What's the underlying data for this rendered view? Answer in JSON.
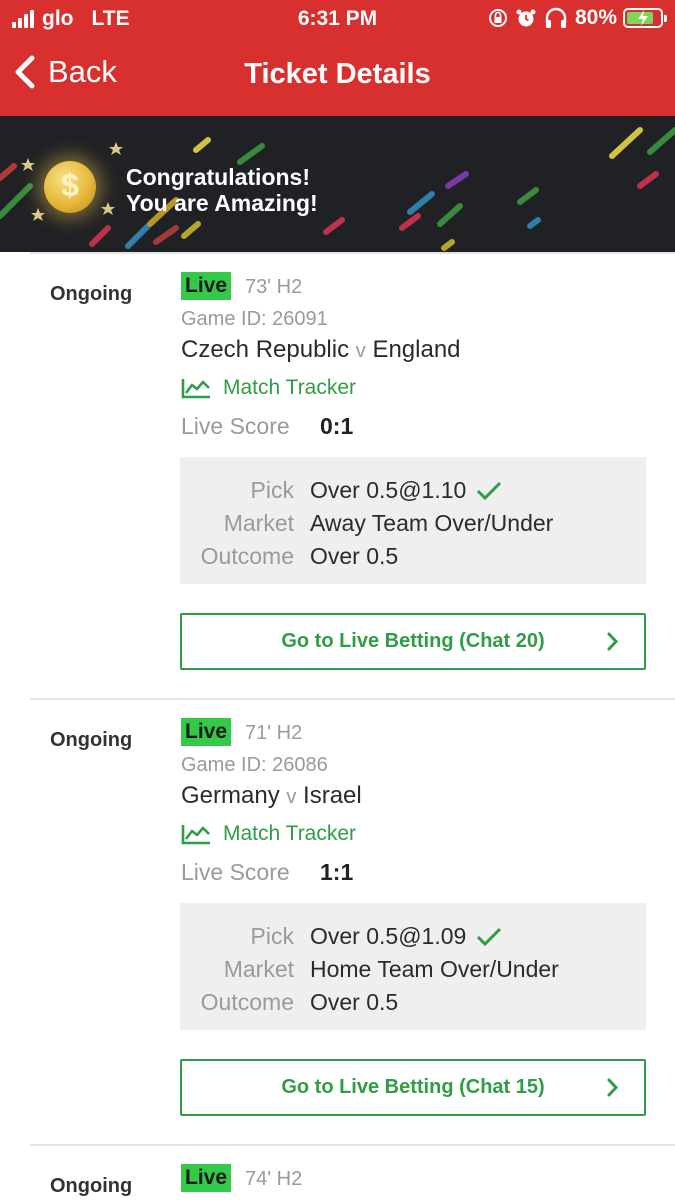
{
  "status_bar": {
    "carrier": "glo",
    "network": "LTE",
    "time": "6:31 PM",
    "battery_percent": "80%",
    "battery_level": 0.8,
    "icons": [
      "signal-icon",
      "orientation-lock-icon",
      "alarm-icon",
      "headphones-icon",
      "battery-icon"
    ]
  },
  "nav": {
    "back_label": "Back",
    "title": "Ticket Details"
  },
  "banner": {
    "line1": "Congratulations!",
    "line2": "You are Amazing!",
    "coin_symbol": "$"
  },
  "colors": {
    "header_red": "#d7302f",
    "live_green": "#35c94a",
    "accent_green": "#2e9d46",
    "banner_dark": "#1f2124"
  },
  "bets": [
    {
      "status": "Ongoing",
      "live_badge": "Live",
      "minute": "73' H2",
      "game_id": "Game ID: 26091",
      "home": "Czech Republic",
      "vs": "v",
      "away": "England",
      "tracker": "Match Tracker",
      "score_label": "Live Score",
      "score": "0:1",
      "pick_label": "Pick",
      "pick": "Over 0.5@1.10",
      "market_label": "Market",
      "market": "Away Team Over/Under",
      "outcome_label": "Outcome",
      "outcome": "Over 0.5",
      "button": "Go to Live Betting (Chat 20)"
    },
    {
      "status": "Ongoing",
      "live_badge": "Live",
      "minute": "71' H2",
      "game_id": "Game ID: 26086",
      "home": "Germany",
      "vs": "v",
      "away": "Israel",
      "tracker": "Match Tracker",
      "score_label": "Live Score",
      "score": "1:1",
      "pick_label": "Pick",
      "pick": "Over 0.5@1.09",
      "market_label": "Market",
      "market": "Home Team Over/Under",
      "outcome_label": "Outcome",
      "outcome": "Over 0.5",
      "button": "Go to Live Betting (Chat 15)"
    },
    {
      "status": "Ongoing",
      "live_badge": "Live",
      "minute": "74' H2"
    }
  ]
}
